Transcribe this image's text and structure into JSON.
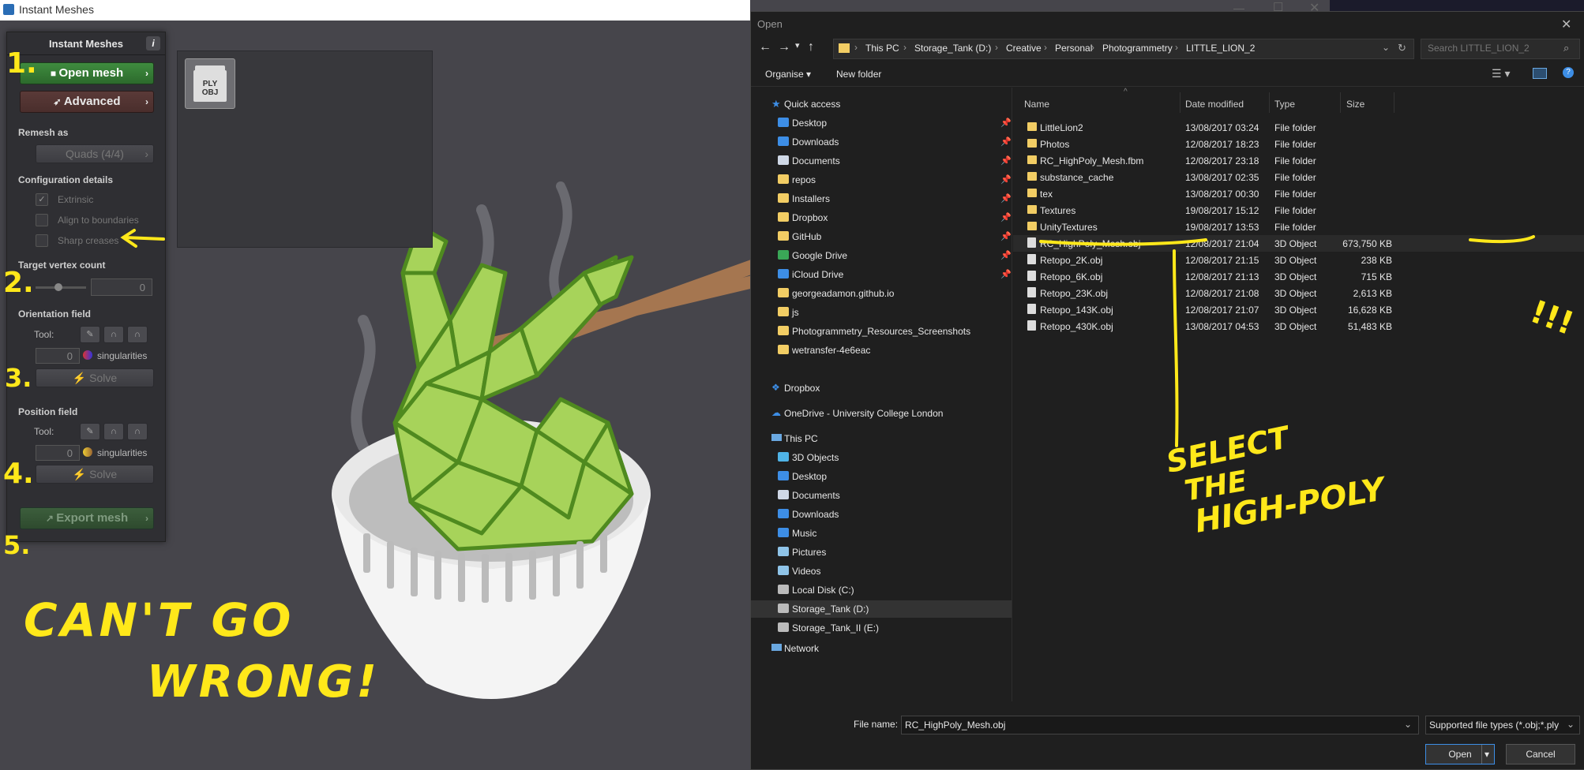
{
  "instant_meshes": {
    "window_title": "Instant Meshes",
    "panel_title": "Instant Meshes",
    "info_label": "i",
    "open_mesh_label": "Open mesh",
    "advanced_label": "Advanced",
    "remesh_as_label": "Remesh as",
    "remesh_value": "Quads (4/4)",
    "config_label": "Configuration details",
    "extrinsic_label": "Extrinsic",
    "align_label": "Align to boundaries",
    "sharp_label": "Sharp creases",
    "target_vertex_label": "Target vertex count",
    "target_vertex_value": "0",
    "orientation_label": "Orientation field",
    "tool_label": "Tool:",
    "orientation_singularities": "0",
    "singularities_label": "singularities",
    "solve_label": "Solve",
    "position_label": "Position field",
    "position_singularities": "0",
    "export_label": "Export mesh",
    "ply_line1": "PLY",
    "ply_line2": "OBJ"
  },
  "dialog": {
    "title": "Open",
    "breadcrumb": [
      "This PC",
      "Storage_Tank (D:)",
      "Creative",
      "Personal",
      "Photogrammetry",
      "LITTLE_LION_2"
    ],
    "search_placeholder": "Search LITTLE_LION_2",
    "organise_label": "Organise",
    "new_folder_label": "New folder",
    "quick_access": "Quick access",
    "nav_quick": [
      {
        "label": "Desktop",
        "icon": "desktop-icon",
        "color": "#3d8ee6",
        "pin": true
      },
      {
        "label": "Downloads",
        "icon": "downloads-icon",
        "color": "#3d8ee6",
        "pin": true
      },
      {
        "label": "Documents",
        "icon": "documents-icon",
        "color": "#cfd8e6",
        "pin": true
      },
      {
        "label": "repos",
        "icon": "folder-icon",
        "color": "#f2cd64",
        "pin": true
      },
      {
        "label": "Installers",
        "icon": "folder-icon",
        "color": "#f2cd64",
        "pin": true
      },
      {
        "label": "Dropbox",
        "icon": "folder-icon",
        "color": "#f2cd64",
        "pin": true
      },
      {
        "label": "GitHub",
        "icon": "folder-icon",
        "color": "#f2cd64",
        "pin": true
      },
      {
        "label": "Google Drive",
        "icon": "google-drive-icon",
        "color": "#3aa757",
        "pin": true
      },
      {
        "label": "iCloud Drive",
        "icon": "icloud-icon",
        "color": "#3d8ee6",
        "pin": true
      },
      {
        "label": "georgeadamon.github.io",
        "icon": "folder-icon",
        "color": "#f2cd64",
        "pin": false
      },
      {
        "label": "js",
        "icon": "folder-icon",
        "color": "#f2cd64",
        "pin": false
      },
      {
        "label": "Photogrammetry_Resources_Screenshots",
        "icon": "folder-icon",
        "color": "#f2cd64",
        "pin": false
      },
      {
        "label": "wetransfer-4e6eac",
        "icon": "folder-icon",
        "color": "#f2cd64",
        "pin": false
      }
    ],
    "dropbox": "Dropbox",
    "onedrive": "OneDrive - University College London",
    "this_pc": "This PC",
    "nav_pc": [
      {
        "label": "3D Objects",
        "icon": "3d-objects-icon",
        "color": "#4fb3e6"
      },
      {
        "label": "Desktop",
        "icon": "desktop-icon",
        "color": "#3d8ee6"
      },
      {
        "label": "Documents",
        "icon": "documents-icon",
        "color": "#cfd8e6"
      },
      {
        "label": "Downloads",
        "icon": "downloads-icon",
        "color": "#3d8ee6"
      },
      {
        "label": "Music",
        "icon": "music-icon",
        "color": "#3d8ee6"
      },
      {
        "label": "Pictures",
        "icon": "pictures-icon",
        "color": "#8fc4e8"
      },
      {
        "label": "Videos",
        "icon": "videos-icon",
        "color": "#8fc4e8"
      },
      {
        "label": "Local Disk (C:)",
        "icon": "drive-icon",
        "color": "#bbbbbb"
      },
      {
        "label": "Storage_Tank (D:)",
        "icon": "drive-icon",
        "color": "#bbbbbb",
        "selected": true
      },
      {
        "label": "Storage_Tank_II (E:)",
        "icon": "drive-icon",
        "color": "#bbbbbb"
      }
    ],
    "network": "Network",
    "columns": {
      "name": "Name",
      "date": "Date modified",
      "type": "Type",
      "size": "Size"
    },
    "files": [
      {
        "name": "LittleLion2",
        "date": "13/08/2017 03:24",
        "type": "File folder",
        "size": "",
        "kind": "folder"
      },
      {
        "name": "Photos",
        "date": "12/08/2017 18:23",
        "type": "File folder",
        "size": "",
        "kind": "folder"
      },
      {
        "name": "RC_HighPoly_Mesh.fbm",
        "date": "12/08/2017 23:18",
        "type": "File folder",
        "size": "",
        "kind": "folder"
      },
      {
        "name": "substance_cache",
        "date": "13/08/2017 02:35",
        "type": "File folder",
        "size": "",
        "kind": "folder"
      },
      {
        "name": "tex",
        "date": "13/08/2017 00:30",
        "type": "File folder",
        "size": "",
        "kind": "folder"
      },
      {
        "name": "Textures",
        "date": "19/08/2017 15:12",
        "type": "File folder",
        "size": "",
        "kind": "folder"
      },
      {
        "name": "UnityTextures",
        "date": "19/08/2017 13:53",
        "type": "File folder",
        "size": "",
        "kind": "folder"
      },
      {
        "name": "RC_HighPoly_Mesh.obj",
        "date": "12/08/2017 21:04",
        "type": "3D Object",
        "size": "673,750 KB",
        "kind": "obj",
        "highlight": true
      },
      {
        "name": "Retopo_2K.obj",
        "date": "12/08/2017 21:15",
        "type": "3D Object",
        "size": "238 KB",
        "kind": "obj"
      },
      {
        "name": "Retopo_6K.obj",
        "date": "12/08/2017 21:13",
        "type": "3D Object",
        "size": "715 KB",
        "kind": "obj"
      },
      {
        "name": "Retopo_23K.obj",
        "date": "12/08/2017 21:08",
        "type": "3D Object",
        "size": "2,613 KB",
        "kind": "obj"
      },
      {
        "name": "Retopo_143K.obj",
        "date": "12/08/2017 21:07",
        "type": "3D Object",
        "size": "16,628 KB",
        "kind": "obj"
      },
      {
        "name": "Retopo_430K.obj",
        "date": "13/08/2017 04:53",
        "type": "3D Object",
        "size": "51,483 KB",
        "kind": "obj"
      }
    ],
    "file_name_label": "File name:",
    "file_name_value": "RC_HighPoly_Mesh.obj",
    "file_type_value": "Supported file types (*.obj;*.ply",
    "open_label": "Open",
    "cancel_label": "Cancel"
  },
  "annotations": {
    "step1": "1.",
    "step2": "2.",
    "step3": "3.",
    "step4": "4.",
    "step5": "5.",
    "cant_line1": "CAN'T GO",
    "cant_line2": "WRONG!",
    "select_line1": "SELECT",
    "select_line2": "THE",
    "select_line3": "HIGH-POLY",
    "exclaim": "!!!"
  }
}
